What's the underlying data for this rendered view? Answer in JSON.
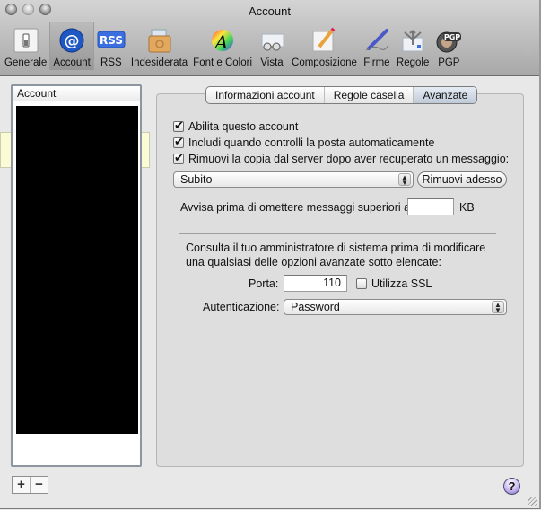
{
  "window": {
    "title": "Account"
  },
  "toolbar": {
    "items": [
      {
        "label": "Generale",
        "icon": "switch-icon",
        "selected": false
      },
      {
        "label": "Account",
        "icon": "at-sign-icon",
        "selected": true
      },
      {
        "label": "RSS",
        "icon": "rss-icon",
        "selected": false
      },
      {
        "label": "Indesiderata",
        "icon": "junk-box-icon",
        "selected": false
      },
      {
        "label": "Font e Colori",
        "icon": "font-color-wheel-icon",
        "selected": false
      },
      {
        "label": "Vista",
        "icon": "glasses-envelope-icon",
        "selected": false
      },
      {
        "label": "Composizione",
        "icon": "pencil-note-icon",
        "selected": false
      },
      {
        "label": "Firme",
        "icon": "pen-signature-icon",
        "selected": false
      },
      {
        "label": "Regole",
        "icon": "rules-arrows-icon",
        "selected": false
      },
      {
        "label": "PGP",
        "icon": "pgp-lock-icon",
        "selected": false
      }
    ],
    "overflow_glyph": "»"
  },
  "account_list": {
    "header": "Account",
    "add_label": "+",
    "remove_label": "−"
  },
  "tabs": [
    {
      "label": "Informazioni account",
      "active": false
    },
    {
      "label": "Regole casella",
      "active": false
    },
    {
      "label": "Avanzate",
      "active": true
    }
  ],
  "advanced": {
    "enable_account": {
      "label": "Abilita questo account",
      "checked": true
    },
    "include_auto_check": {
      "label": "Includi quando controlli la posta automaticamente",
      "checked": true
    },
    "remove_copy": {
      "label": "Rimuovi la copia dal server dopo aver recuperato un messaggio:",
      "checked": true
    },
    "remove_when": {
      "selected": "Subito"
    },
    "remove_now_button": "Rimuovi adesso",
    "warn_size_label": "Avvisa prima di omettere messaggi superiori a",
    "warn_size_value": "",
    "warn_size_unit": "KB",
    "admin_notice_line1": "Consulta il tuo amministratore di sistema prima di modificare",
    "admin_notice_line2": "una qualsiasi delle opzioni avanzate sotto elencate:",
    "port_label": "Porta:",
    "port_value": "110",
    "use_ssl": {
      "label": "Utilizza SSL",
      "checked": false
    },
    "auth_label": "Autenticazione:",
    "auth_selected": "Password"
  },
  "help_button": "?"
}
